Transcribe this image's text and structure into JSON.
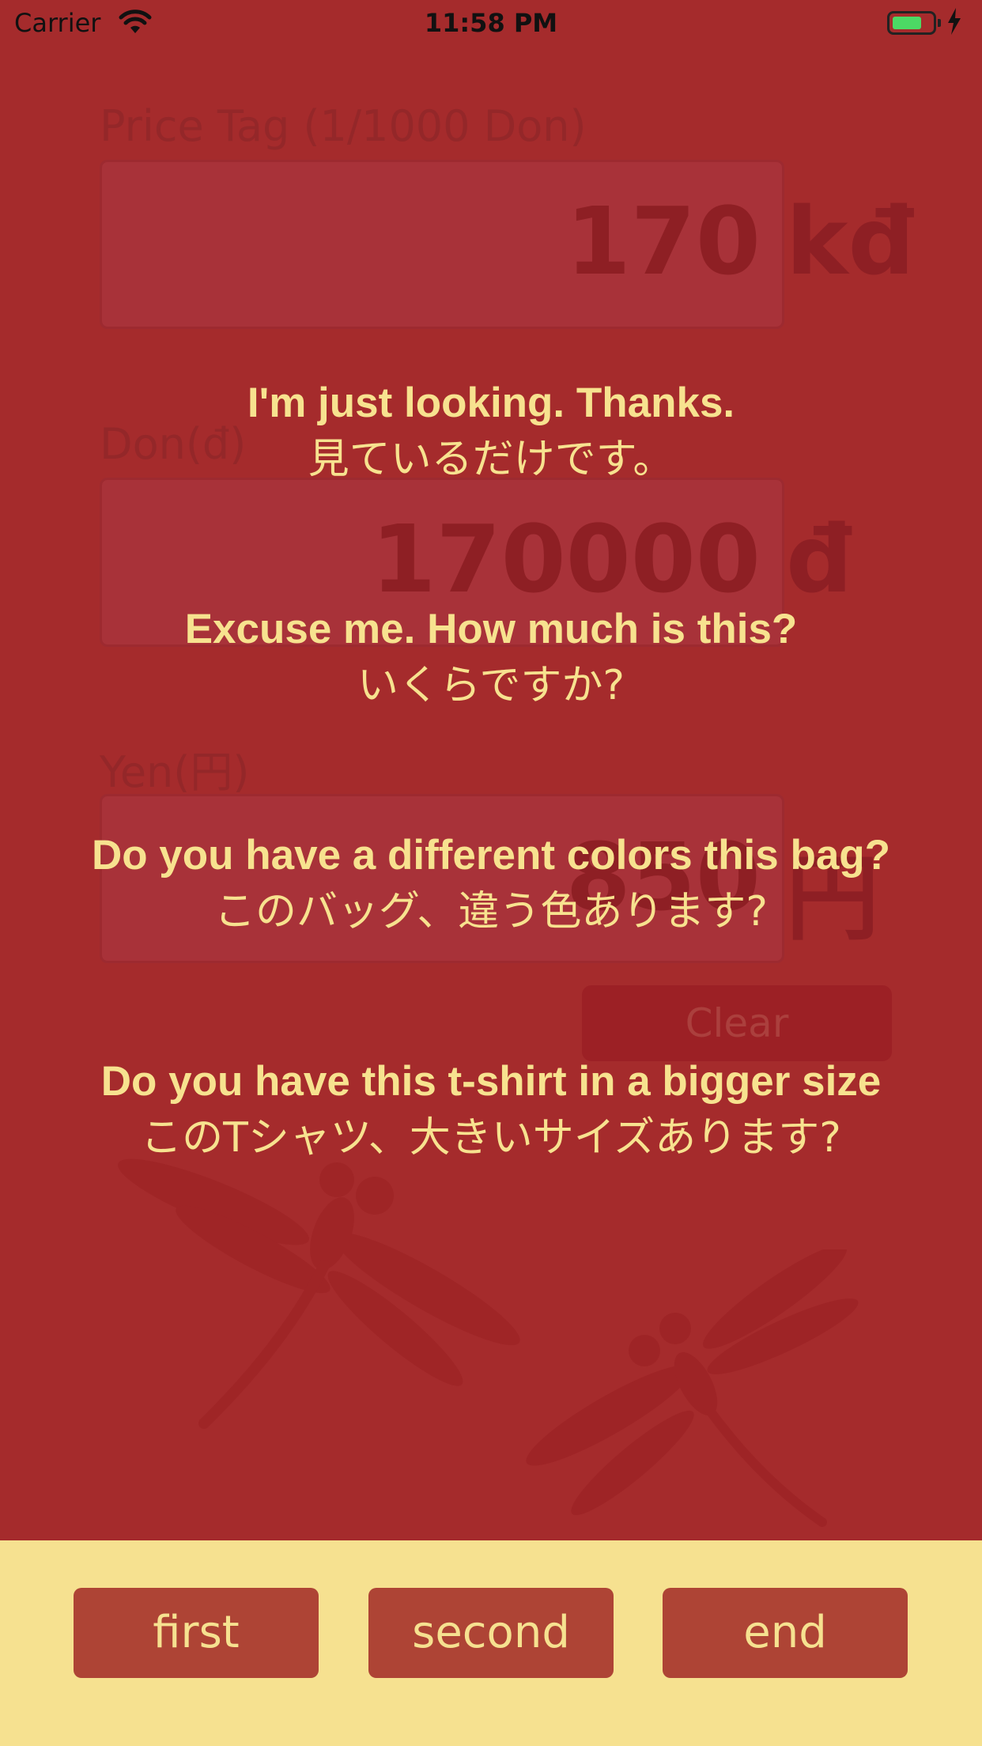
{
  "status_bar": {
    "carrier": "Carrier",
    "time": "11:58 PM",
    "icons": [
      "wifi-icon",
      "battery-icon",
      "charging-icon"
    ]
  },
  "form": {
    "price_tag": {
      "label": "Price Tag (1/1000 Don)",
      "value": "170",
      "unit": "kđ"
    },
    "don": {
      "label": "Don(đ)",
      "value": "170000",
      "unit": "đ"
    },
    "yen": {
      "label": "Yen(円)",
      "value": "850",
      "unit": "円"
    },
    "clear_label": "Clear"
  },
  "phrases": [
    {
      "en": "I'm just looking. Thanks.",
      "ja": "見ているだけです。"
    },
    {
      "en": "Excuse me. How much is this?",
      "ja": "いくらですか?"
    },
    {
      "en": "Do you have a different colors this bag?",
      "ja": "このバッグ、違う色あります?"
    },
    {
      "en": "Do you have this t-shirt in a bigger size",
      "ja": "このTシャツ、大きいサイズあります?"
    }
  ],
  "toolbar": {
    "first_label": "first",
    "second_label": "second",
    "end_label": "end"
  },
  "colors": {
    "background": "#a52b2c",
    "phrase_text": "#f7e28f",
    "toolbar_background": "#f6e190",
    "toolbar_button": "#ae4435",
    "battery_fill": "#4cd964"
  }
}
